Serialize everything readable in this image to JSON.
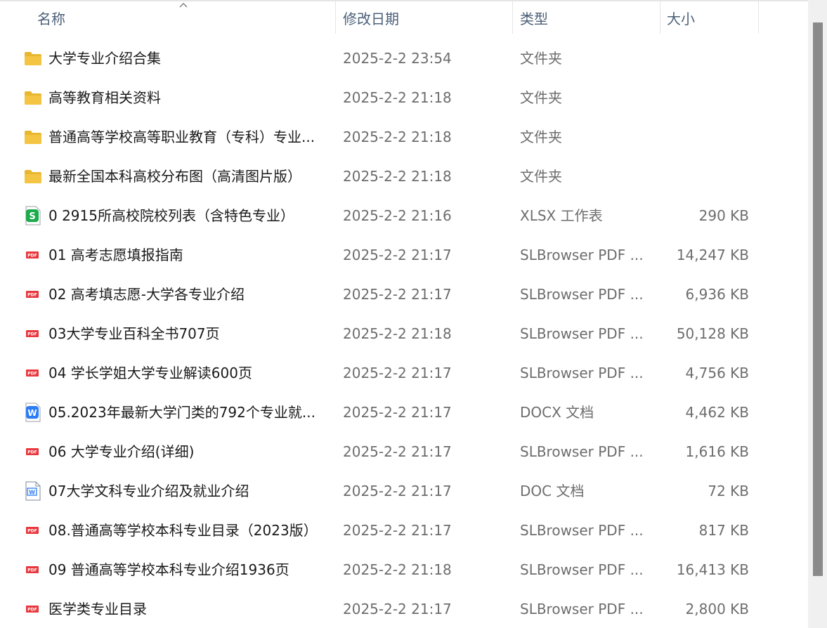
{
  "header": {
    "name": "名称",
    "date": "修改日期",
    "type": "类型",
    "size": "大小"
  },
  "files": [
    {
      "icon": "folder-icon",
      "name": "大学专业介绍合集",
      "date": "2025-2-2 23:54",
      "type": "文件夹",
      "size": ""
    },
    {
      "icon": "folder-icon",
      "name": "高等教育相关资料",
      "date": "2025-2-2 21:18",
      "type": "文件夹",
      "size": ""
    },
    {
      "icon": "folder-icon",
      "name": "普通高等学校高等职业教育（专科）专业...",
      "date": "2025-2-2 21:18",
      "type": "文件夹",
      "size": ""
    },
    {
      "icon": "folder-icon",
      "name": "最新全国本科高校分布图（高清图片版）",
      "date": "2025-2-2 21:18",
      "type": "文件夹",
      "size": ""
    },
    {
      "icon": "xlsx-icon",
      "name": "0 2915所高校院校列表（含特色专业）",
      "date": "2025-2-2 21:16",
      "type": "XLSX 工作表",
      "size": "290 KB"
    },
    {
      "icon": "pdf-icon",
      "name": "01 高考志愿填报指南",
      "date": "2025-2-2 21:17",
      "type": "SLBrowser PDF ...",
      "size": "14,247 KB"
    },
    {
      "icon": "pdf-icon",
      "name": "02 高考填志愿-大学各专业介绍",
      "date": "2025-2-2 21:17",
      "type": "SLBrowser PDF ...",
      "size": "6,936 KB"
    },
    {
      "icon": "pdf-icon",
      "name": "03大学专业百科全书707页",
      "date": "2025-2-2 21:18",
      "type": "SLBrowser PDF ...",
      "size": "50,128 KB"
    },
    {
      "icon": "pdf-icon",
      "name": "04 学长学姐大学专业解读600页",
      "date": "2025-2-2 21:17",
      "type": "SLBrowser PDF ...",
      "size": "4,756 KB"
    },
    {
      "icon": "docx-icon",
      "name": "05.2023年最新大学门类的792个专业就...",
      "date": "2025-2-2 21:17",
      "type": "DOCX 文档",
      "size": "4,462 KB"
    },
    {
      "icon": "pdf-icon",
      "name": "06 大学专业介绍(详细)",
      "date": "2025-2-2 21:17",
      "type": "SLBrowser PDF ...",
      "size": "1,616 KB"
    },
    {
      "icon": "doc-icon",
      "name": "07大学文科专业介绍及就业介绍",
      "date": "2025-2-2 21:17",
      "type": "DOC 文档",
      "size": "72 KB"
    },
    {
      "icon": "pdf-icon",
      "name": "08.普通高等学校本科专业目录（2023版）",
      "date": "2025-2-2 21:17",
      "type": "SLBrowser PDF ...",
      "size": "817 KB"
    },
    {
      "icon": "pdf-icon",
      "name": "09 普通高等学校本科专业介绍1936页",
      "date": "2025-2-2 21:18",
      "type": "SLBrowser PDF ...",
      "size": "16,413 KB"
    },
    {
      "icon": "pdf-icon",
      "name": "医学类专业目录",
      "date": "2025-2-2 21:17",
      "type": "SLBrowser PDF ...",
      "size": "2,800 KB"
    }
  ],
  "icon_labels": {
    "pdf": "PDF",
    "xlsx": "S",
    "docx": "W"
  },
  "colors": {
    "folder": "#f4c542",
    "pdf": "#e8373d",
    "xlsx": "#1aab4b",
    "docx": "#2b7cf6",
    "scroll_thumb": "#8a8a8a"
  }
}
